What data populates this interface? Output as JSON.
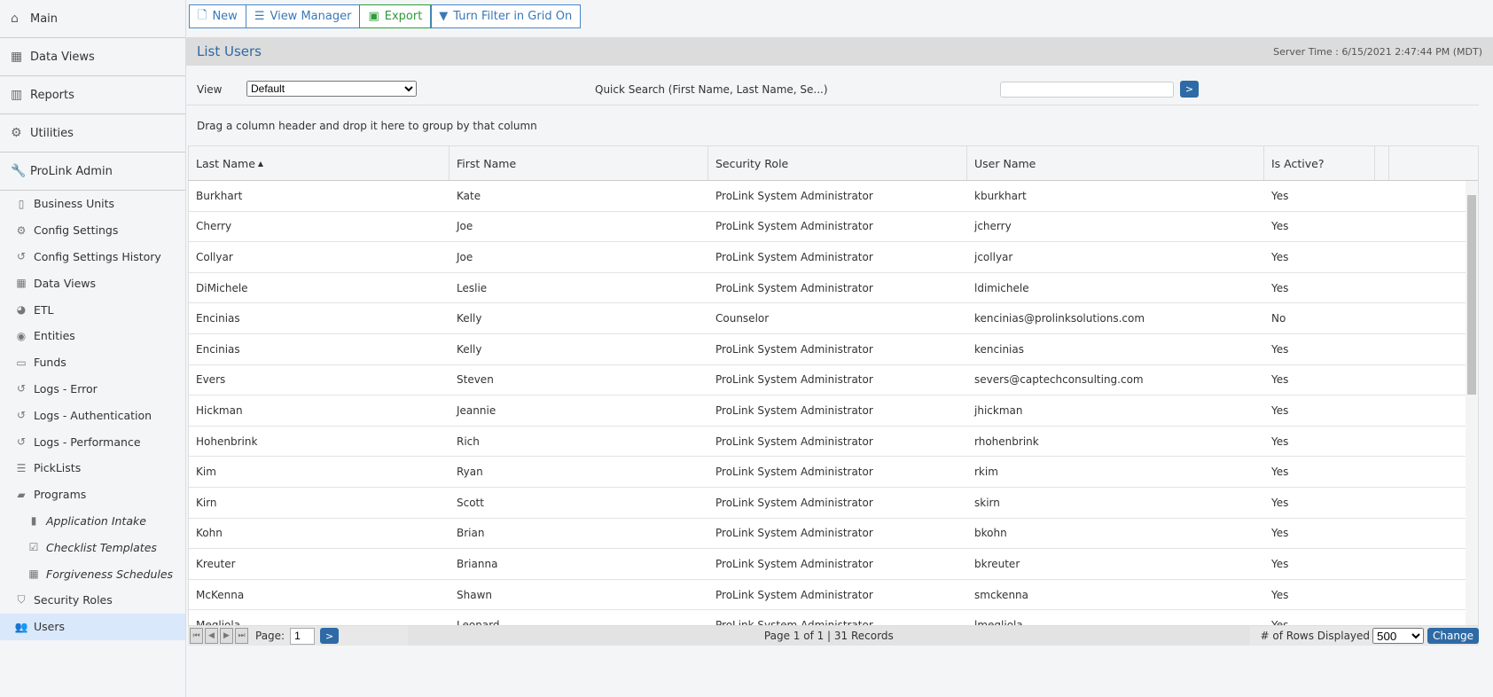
{
  "sidebar": {
    "top": [
      {
        "label": "Main",
        "icon": "home-icon",
        "glyph": "⌂"
      },
      {
        "label": "Data Views",
        "icon": "table-icon",
        "glyph": "▦"
      },
      {
        "label": "Reports",
        "icon": "bar-chart-icon",
        "glyph": "▥"
      },
      {
        "label": "Utilities",
        "icon": "gears-icon",
        "glyph": "⚙"
      },
      {
        "label": "ProLink Admin",
        "icon": "wrench-icon",
        "glyph": "🔧"
      }
    ],
    "items": [
      {
        "label": "Business Units",
        "icon": "building-icon",
        "glyph": "▯"
      },
      {
        "label": "Config Settings",
        "icon": "gears-icon",
        "glyph": "⚙"
      },
      {
        "label": "Config Settings History",
        "icon": "history-icon",
        "glyph": "↺"
      },
      {
        "label": "Data Views",
        "icon": "table-icon",
        "glyph": "▦"
      },
      {
        "label": "ETL",
        "icon": "pie-chart-icon",
        "glyph": "◕"
      },
      {
        "label": "Entities",
        "icon": "user-circle-icon",
        "glyph": "◉"
      },
      {
        "label": "Funds",
        "icon": "money-icon",
        "glyph": "▭"
      },
      {
        "label": "Logs - Error",
        "icon": "history-icon",
        "glyph": "↺"
      },
      {
        "label": "Logs - Authentication",
        "icon": "history-icon",
        "glyph": "↺"
      },
      {
        "label": "Logs - Performance",
        "icon": "history-icon",
        "glyph": "↺"
      },
      {
        "label": "PickLists",
        "icon": "sliders-icon",
        "glyph": "☰"
      },
      {
        "label": "Programs",
        "icon": "briefcase-icon",
        "glyph": "▰"
      },
      {
        "label": "Application Intake",
        "icon": "file-icon",
        "glyph": "▮",
        "nested": true
      },
      {
        "label": "Checklist Templates",
        "icon": "checkbox-icon",
        "glyph": "☑",
        "nested": true
      },
      {
        "label": "Forgiveness Schedules",
        "icon": "calendar-icon",
        "glyph": "▦",
        "nested": true
      },
      {
        "label": "Security Roles",
        "icon": "shield-icon",
        "glyph": "⛉"
      },
      {
        "label": "Users",
        "icon": "users-icon",
        "glyph": "👥",
        "active": true
      }
    ]
  },
  "toolbar": {
    "new": "New",
    "view_manager": "View Manager",
    "export": "Export",
    "filter": "Turn Filter in Grid On"
  },
  "header": {
    "title": "List Users",
    "server_time": "Server Time : 6/15/2021 2:47:44 PM (MDT)"
  },
  "filters": {
    "view_label": "View",
    "view_value": "Default",
    "quick_search_label": "Quick Search (First Name, Last Name, Se...)",
    "quick_search_value": "",
    "go": ">"
  },
  "group_hint": "Drag a column header and drop it here to group by that column",
  "grid": {
    "columns": [
      "Last Name",
      "First Name",
      "Security Role",
      "User Name",
      "Is Active?"
    ],
    "sort_indicator": "▲",
    "rows": [
      [
        "Burkhart",
        "Kate",
        "ProLink System Administrator",
        "kburkhart",
        "Yes"
      ],
      [
        "Cherry",
        "Joe",
        "ProLink System Administrator",
        "jcherry",
        "Yes"
      ],
      [
        "Collyar",
        "Joe",
        "ProLink System Administrator",
        "jcollyar",
        "Yes"
      ],
      [
        "DiMichele",
        "Leslie",
        "ProLink System Administrator",
        "ldimichele",
        "Yes"
      ],
      [
        "Encinias",
        "Kelly",
        "Counselor",
        "kencinias@prolinksolutions.com",
        "No"
      ],
      [
        "Encinias",
        "Kelly",
        "ProLink System Administrator",
        "kencinias",
        "Yes"
      ],
      [
        "Evers",
        "Steven",
        "ProLink System Administrator",
        "severs@captechconsulting.com",
        "Yes"
      ],
      [
        "Hickman",
        "Jeannie",
        "ProLink System Administrator",
        "jhickman",
        "Yes"
      ],
      [
        "Hohenbrink",
        "Rich",
        "ProLink System Administrator",
        "rhohenbrink",
        "Yes"
      ],
      [
        "Kim",
        "Ryan",
        "ProLink System Administrator",
        "rkim",
        "Yes"
      ],
      [
        "Kirn",
        "Scott",
        "ProLink System Administrator",
        "skirn",
        "Yes"
      ],
      [
        "Kohn",
        "Brian",
        "ProLink System Administrator",
        "bkohn",
        "Yes"
      ],
      [
        "Kreuter",
        "Brianna",
        "ProLink System Administrator",
        "bkreuter",
        "Yes"
      ],
      [
        "McKenna",
        "Shawn",
        "ProLink System Administrator",
        "smckenna",
        "Yes"
      ],
      [
        "Megliola",
        "Leonard",
        "ProLink System Administrator",
        "lmegliola",
        "Yes"
      ]
    ]
  },
  "pager": {
    "page_label": "Page:",
    "page_value": "1",
    "go": ">",
    "summary": "Page 1 of 1 | 31 Records",
    "rows_label": "# of Rows Displayed",
    "rows_value": "500",
    "change": "Change"
  }
}
